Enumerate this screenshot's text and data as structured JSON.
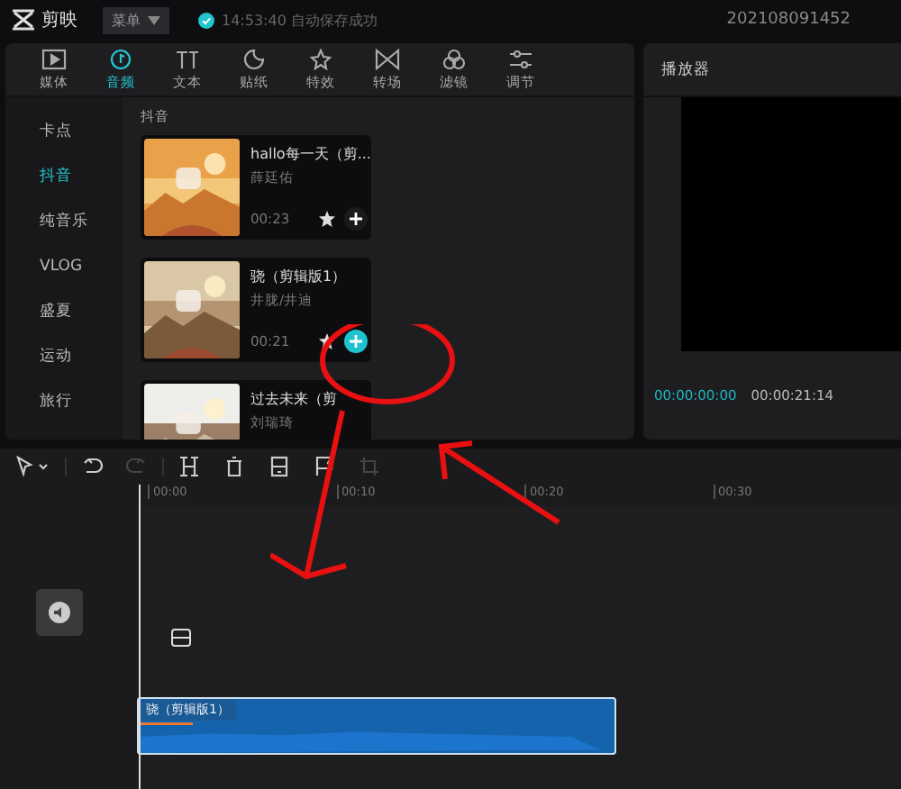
{
  "app": {
    "name": "剪映",
    "menu": "菜单",
    "autosave": "14:53:40 自动保存成功",
    "project": "202108091452"
  },
  "tabs": [
    {
      "kind": "media",
      "label": "媒体",
      "selected": false
    },
    {
      "kind": "audio",
      "label": "音频",
      "selected": true
    },
    {
      "kind": "text",
      "label": "文本",
      "selected": false
    },
    {
      "kind": "sticker",
      "label": "贴纸",
      "selected": false
    },
    {
      "kind": "effect",
      "label": "特效",
      "selected": false
    },
    {
      "kind": "transition",
      "label": "转场",
      "selected": false
    },
    {
      "kind": "filter",
      "label": "滤镜",
      "selected": false
    },
    {
      "kind": "adjust",
      "label": "调节",
      "selected": false
    }
  ],
  "sidebar": {
    "items": [
      {
        "label": "卡点",
        "selected": false
      },
      {
        "label": "抖音",
        "selected": true
      },
      {
        "label": "纯音乐",
        "selected": false
      },
      {
        "label": "VLOG",
        "selected": false
      },
      {
        "label": "盛夏",
        "selected": false
      },
      {
        "label": "运动",
        "selected": false
      },
      {
        "label": "旅行",
        "selected": false
      }
    ]
  },
  "section_title": "抖音",
  "songs": [
    {
      "title": "hallo每一天（剪...",
      "artist": "薛廷佑",
      "duration": "00:23",
      "add_highlighted": false
    },
    {
      "title": "骁（剪辑版1）",
      "artist": "井胧/井迪",
      "duration": "00:21",
      "add_highlighted": true
    },
    {
      "title": "过去未来（剪",
      "artist": "刘瑞琦"
    }
  ],
  "player": {
    "title": "播放器",
    "current_time": "00:00:00:00",
    "total_time": "00:00:21:14"
  },
  "toolbar": [
    {
      "kind": "select"
    },
    {
      "kind": "undo",
      "disabled": false
    },
    {
      "kind": "redo",
      "disabled": true
    },
    {
      "kind": "split",
      "disabled": false
    },
    {
      "kind": "delete",
      "disabled": false
    },
    {
      "kind": "freeze",
      "disabled": false
    },
    {
      "kind": "marker",
      "disabled": false
    },
    {
      "kind": "crop",
      "disabled": true
    }
  ],
  "ruler": [
    "00:00",
    "00:10",
    "00:20",
    "00:30"
  ],
  "audio_clip": {
    "title": "骁（剪辑版1）"
  }
}
